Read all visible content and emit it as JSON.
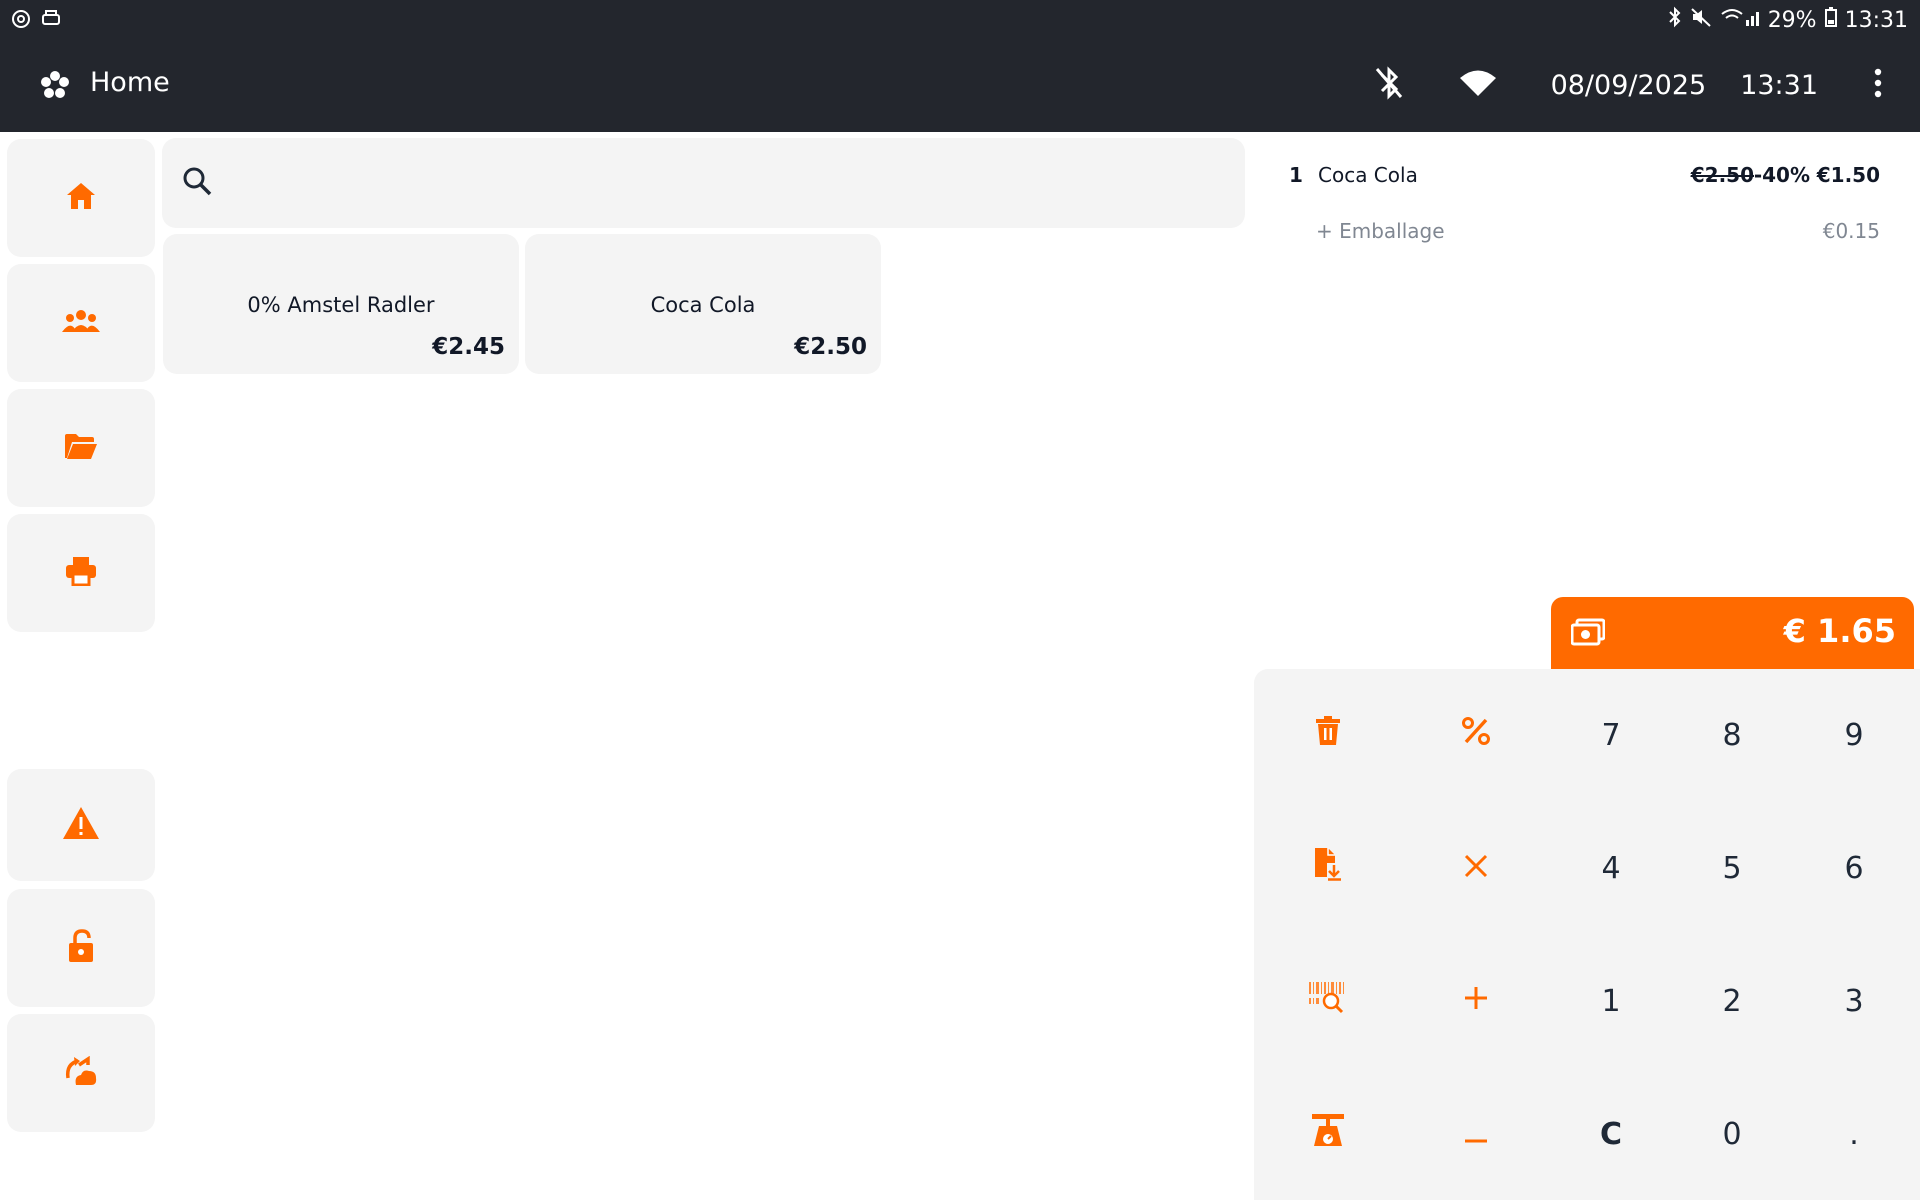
{
  "status_bar": {
    "battery": "29%",
    "time": "13:31"
  },
  "app_bar": {
    "title": "Home",
    "date": "08/09/2025",
    "time": "13:31"
  },
  "sidebar": {
    "items": [
      {
        "name": "home-icon"
      },
      {
        "name": "customers-icon"
      },
      {
        "name": "folder-icon"
      },
      {
        "name": "printer-icon"
      },
      {
        "name": "warning-icon"
      },
      {
        "name": "unlock-icon"
      },
      {
        "name": "sync-icon"
      }
    ]
  },
  "search": {
    "placeholder": ""
  },
  "products": [
    {
      "name": "0% Amstel Radler",
      "price": "€2.45"
    },
    {
      "name": "Coca Cola",
      "price": "€2.50"
    }
  ],
  "order": {
    "lines": [
      {
        "qty": "1",
        "name": "Coca Cola",
        "old_price": "€2.50",
        "discount": "-40%",
        "price": "€1.50"
      }
    ],
    "sub_lines": [
      {
        "name": "+ Emballage",
        "price": "€0.15"
      }
    ],
    "total": "€ 1.65"
  },
  "keypad": {
    "keys": [
      "7",
      "8",
      "9",
      "4",
      "5",
      "6",
      "1",
      "2",
      "3",
      "C",
      "0",
      "."
    ]
  },
  "colors": {
    "accent": "#ff6a00",
    "bar": "#23262d",
    "tile": "#f4f4f4"
  }
}
